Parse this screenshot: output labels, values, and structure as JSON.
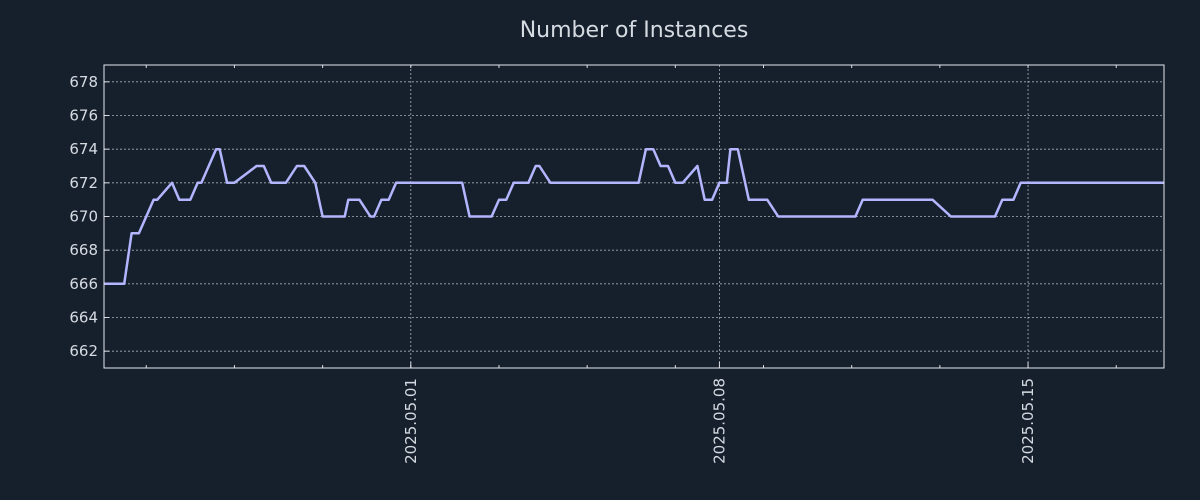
{
  "chart_data": {
    "type": "line",
    "title": "Number of Instances",
    "xlabel": "",
    "ylabel": "",
    "grid": true,
    "legend": "none",
    "colors": {
      "background": "#16202d",
      "line": "#b3b6ff",
      "text": "#d6dbe2",
      "grid": "#d9dde3"
    },
    "x_tick_labels": [
      "2025.05.01",
      "2025.05.08",
      "2025.05.15"
    ],
    "x_ticks": [
      "2025-05-01",
      "2025-05-08",
      "2025-05-15"
    ],
    "xlim": [
      "2025-04-24 01:00",
      "2025-05-18 02:00"
    ],
    "ylim": [
      661,
      679
    ],
    "y_ticks": [
      662,
      664,
      666,
      668,
      670,
      672,
      674,
      676,
      678
    ],
    "series": [
      {
        "x": [
          "2025-04-24 01:00",
          "2025-04-24 12:00",
          "2025-04-24 16:00",
          "2025-04-24 20:00",
          "2025-04-25 04:00",
          "2025-04-25 06:00",
          "2025-04-25 14:00",
          "2025-04-25 18:00",
          "2025-04-26 00:00",
          "2025-04-26 04:00",
          "2025-04-26 06:00",
          "2025-04-26 14:00",
          "2025-04-26 16:00",
          "2025-04-26 20:00",
          "2025-04-27 00:00",
          "2025-04-27 12:00",
          "2025-04-27 16:00",
          "2025-04-27 20:00",
          "2025-04-28 04:00",
          "2025-04-28 10:00",
          "2025-04-28 14:00",
          "2025-04-28 20:00",
          "2025-04-29 00:00",
          "2025-04-29 12:00",
          "2025-04-29 14:00",
          "2025-04-29 20:00",
          "2025-04-30 02:00",
          "2025-04-30 04:00",
          "2025-04-30 08:00",
          "2025-04-30 12:00",
          "2025-04-30 16:00",
          "2025-05-02 04:00",
          "2025-05-02 08:00",
          "2025-05-02 20:00",
          "2025-05-03 00:00",
          "2025-05-03 04:00",
          "2025-05-03 08:00",
          "2025-05-03 16:00",
          "2025-05-03 20:00",
          "2025-05-03 22:00",
          "2025-05-04 04:00",
          "2025-05-06 04:00",
          "2025-05-06 08:00",
          "2025-05-06 12:00",
          "2025-05-06 16:00",
          "2025-05-06 20:00",
          "2025-05-07 00:00",
          "2025-05-07 04:00",
          "2025-05-07 12:00",
          "2025-05-07 16:00",
          "2025-05-07 20:00",
          "2025-05-08 00:00",
          "2025-05-08 04:00",
          "2025-05-08 06:00",
          "2025-05-08 10:00",
          "2025-05-08 16:00",
          "2025-05-09 02:00",
          "2025-05-09 08:00",
          "2025-05-11 02:00",
          "2025-05-11 06:00",
          "2025-05-12 20:00",
          "2025-05-13 06:00",
          "2025-05-14 06:00",
          "2025-05-14 10:00",
          "2025-05-14 16:00",
          "2025-05-14 20:00",
          "2025-05-15 20:00",
          "2025-05-16 00:00",
          "2025-05-16 08:00",
          "2025-05-16 12:00",
          "2025-05-16 16:00",
          "2025-05-16 20:00",
          "2025-05-18 02:00"
        ],
        "y": [
          666,
          666,
          669,
          669,
          671,
          671,
          672,
          671,
          671,
          672,
          672,
          674,
          674,
          672,
          672,
          673,
          673,
          672,
          672,
          673,
          673,
          672,
          670,
          670,
          671,
          671,
          670,
          670,
          671,
          671,
          672,
          672,
          670,
          670,
          671,
          671,
          672,
          672,
          673,
          673,
          672,
          672,
          674,
          674,
          673,
          673,
          672,
          672,
          673,
          671,
          671,
          672,
          672,
          674,
          674,
          671,
          671,
          670,
          670,
          671,
          671,
          670,
          670,
          671,
          671,
          672,
          672,
          672,
          672,
          672,
          672,
          672,
          672
        ]
      }
    ]
  }
}
